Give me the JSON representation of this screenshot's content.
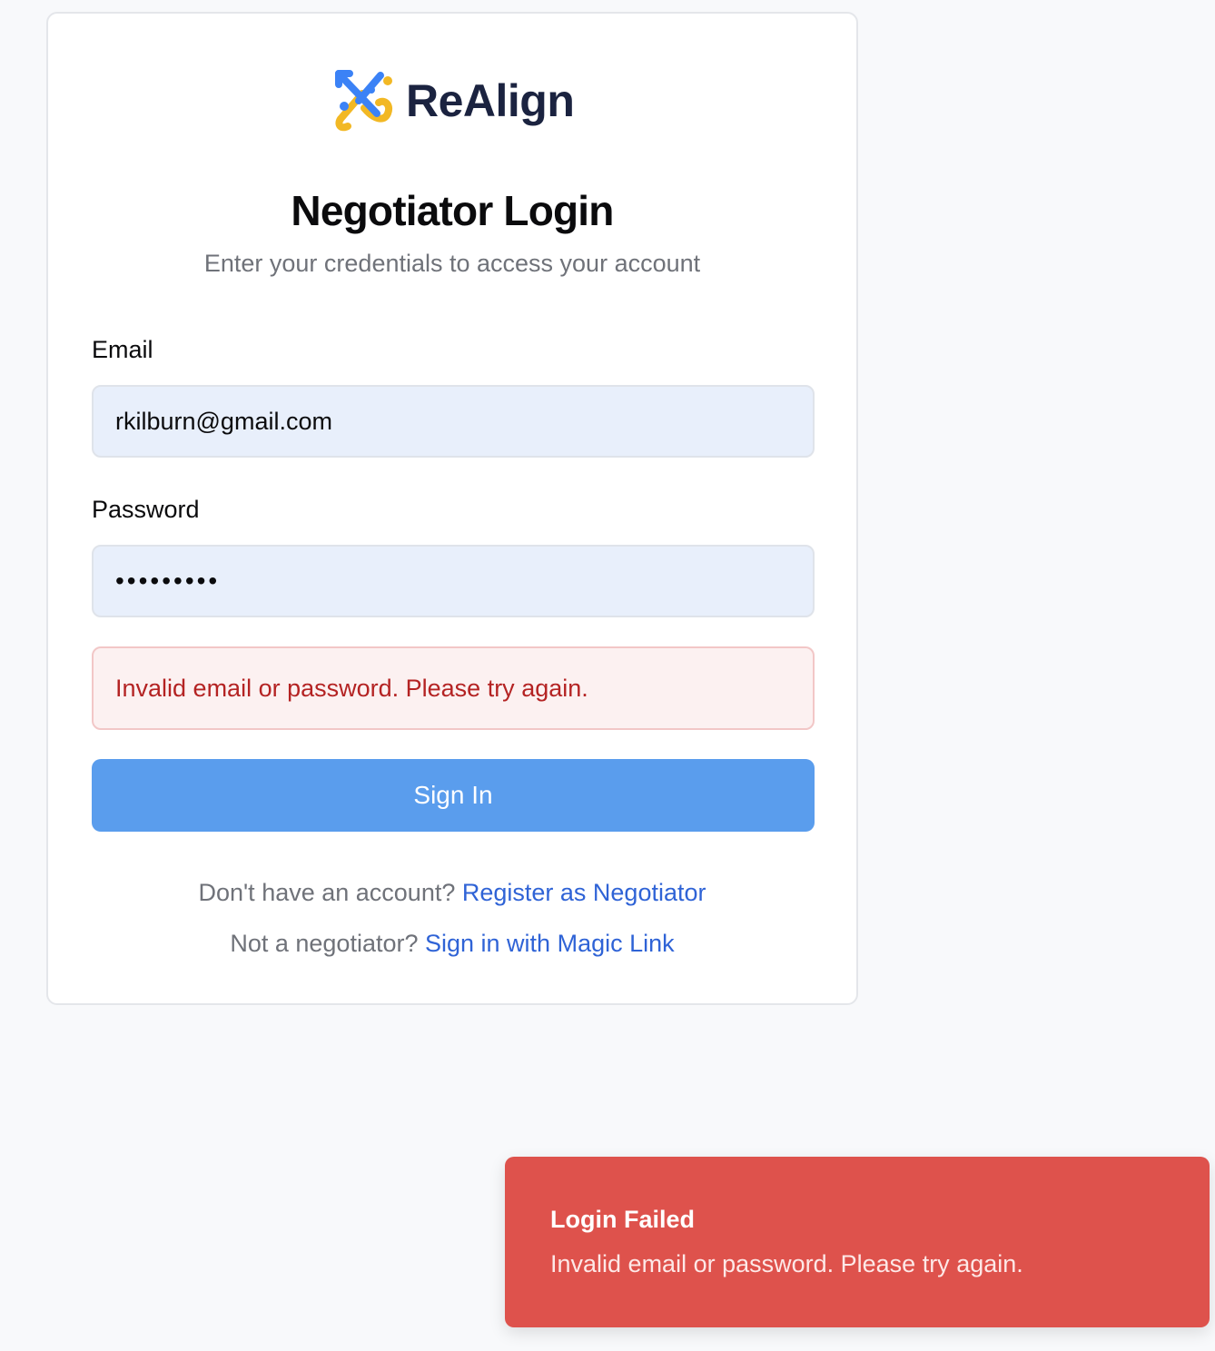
{
  "brand": {
    "name": "ReAlign",
    "logo_icon": "realign-logo-icon",
    "colors": {
      "blue": "#3b82f6",
      "yellow": "#f2b824",
      "navy": "#1b2340"
    }
  },
  "login": {
    "title": "Negotiator Login",
    "subtitle": "Enter your credentials to access your account",
    "email_label": "Email",
    "email_value": "rkilburn@gmail.com",
    "password_label": "Password",
    "password_value": "•••••••••",
    "error_message": "Invalid email or password. Please try again.",
    "submit_label": "Sign In",
    "register_prompt": "Don't have an account?",
    "register_link": "Register as Negotiator",
    "magic_prompt": "Not a negotiator?",
    "magic_link": "Sign in with Magic Link"
  },
  "toast": {
    "title": "Login Failed",
    "message": "Invalid email or password. Please try again.",
    "color": "#de524c"
  }
}
